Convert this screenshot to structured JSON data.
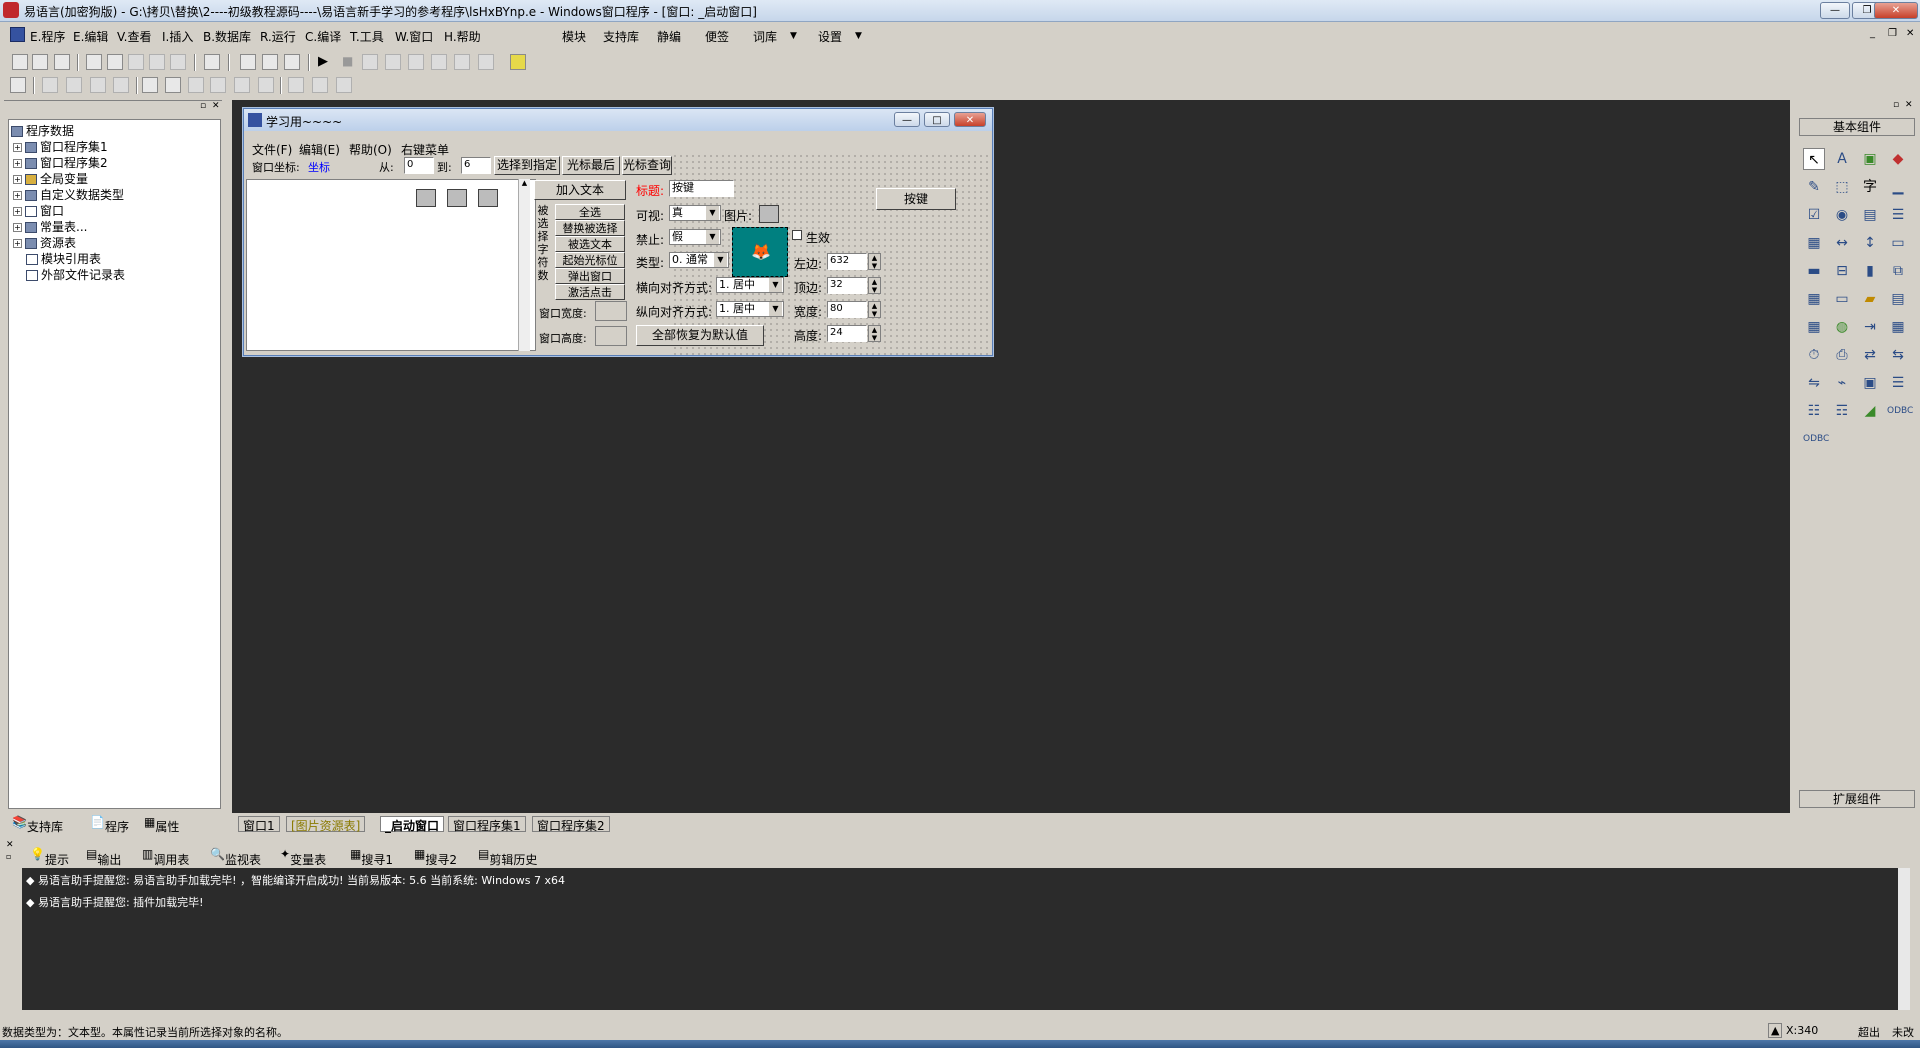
{
  "app": {
    "title": "易语言(加密狗版) - G:\\拷贝\\替换\\2----初级教程源码----\\易语言新手学习的参考程序\\lsHxBYnp.e - Windows窗口程序 - [窗口: _启动窗口]"
  },
  "menu": [
    "E.程序",
    "E.编辑",
    "V.查看",
    "I.插入",
    "B.数据库",
    "R.运行",
    "C.编译",
    "T.工具",
    "W.窗口",
    "H.帮助",
    "模块",
    "支持库",
    "静编",
    "便签",
    "词库",
    "设置"
  ],
  "tree": {
    "root": "程序数据",
    "items": [
      "窗口程序集1",
      "窗口程序集2",
      "全局变量",
      "自定义数据类型",
      "窗口",
      "常量表...",
      "资源表",
      "模块引用表",
      "外部文件记录表"
    ]
  },
  "left_tabs": [
    "支持库",
    "程序",
    "属性"
  ],
  "form": {
    "title": "学习用~~~~",
    "menu": [
      "文件(F)",
      "编辑(E)",
      "帮助(O)",
      "右键菜单"
    ],
    "coord_label": "窗口坐标:",
    "coord_link": "坐标",
    "from_label": "从:",
    "from_value": "0",
    "to_label": "到:",
    "to_value": "6",
    "top_buttons": [
      "选择到指定",
      "光标最后",
      "光标查询"
    ],
    "add_text": "加入文本",
    "side_label": "被选择字符数",
    "mid_buttons": [
      "全选",
      "替换被选择",
      "被选文本",
      "起始光标位",
      "弹出窗口",
      "激活点击"
    ],
    "win_width": "窗口宽度:",
    "win_height": "窗口高度:",
    "title_label": "标题:",
    "title_value": "按键",
    "visible_label": "可视:",
    "visible_value": "真",
    "picture_label": "图片:",
    "disable_label": "禁止:",
    "disable_value": "假",
    "effect_label": "生效",
    "type_label": "类型:",
    "type_value": "0. 通常",
    "halign_label": "横向对齐方式:",
    "halign_value": "1. 居中",
    "valign_label": "纵向对齐方式:",
    "valign_value": "1. 居中",
    "restore": "全部恢复为默认值",
    "left_label": "左边:",
    "left_value": "632",
    "top_label": "顶边:",
    "top_value": "32",
    "width_label": "宽度:",
    "width_value": "80",
    "height_label": "高度:",
    "height_value": "24",
    "key_button": "按键"
  },
  "doc_tabs": [
    "窗口1",
    "[图片资源表]",
    "_启动窗口",
    "窗口程序集1",
    "窗口程序集2"
  ],
  "tools": {
    "basic": "基本组件",
    "ext": "扩展组件"
  },
  "output_tabs": [
    "提示",
    "输出",
    "调用表",
    "监视表",
    "变量表",
    "搜寻1",
    "搜寻2",
    "剪辑历史"
  ],
  "output_lines": [
    "易语言助手提醒您: 易语言助手加载完毕! ，智能编译开启成功! 当前易版本: 5.6  当前系统: Windows 7 x64",
    "易语言助手提醒您: 插件加载完毕!"
  ],
  "status": {
    "message": "数据类型为：文本型。本属性记录当前所选择对象的名称。",
    "x": "X:340",
    "mode": "超出",
    "save": "未改"
  },
  "colors": {
    "workspace": "#2b2b2b",
    "red_label": "#ff0000",
    "selected": "#008080"
  }
}
